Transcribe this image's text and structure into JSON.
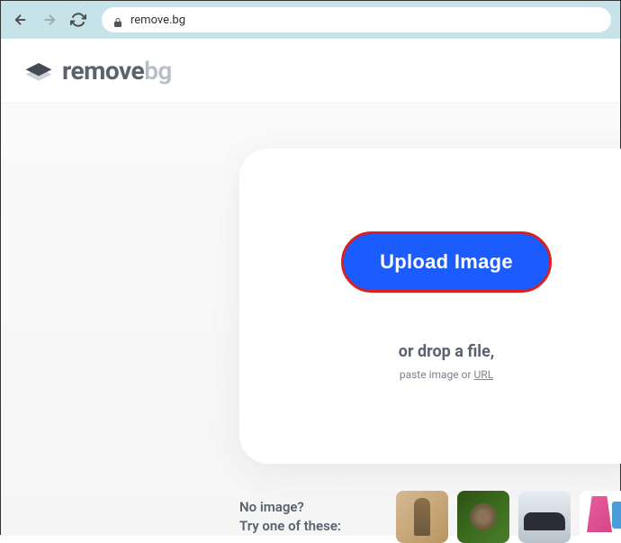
{
  "browser": {
    "url": "remove.bg"
  },
  "header": {
    "logo_main": "remove",
    "logo_sub": "bg"
  },
  "upload": {
    "button_label": "Upload Image",
    "drop_text": "or drop a file,",
    "paste_prefix": "paste image or ",
    "paste_link": "URL"
  },
  "try": {
    "line1": "No image?",
    "line2": "Try one of these:"
  }
}
